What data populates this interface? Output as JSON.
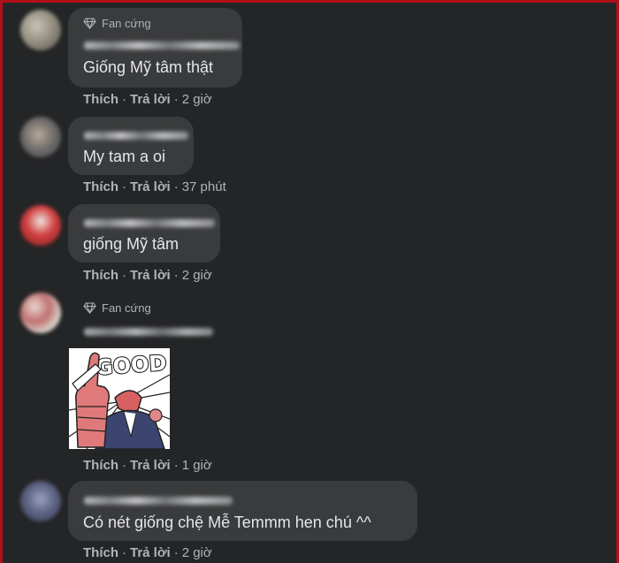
{
  "comments": [
    {
      "badge": "Fan cứng",
      "text": "Giống Mỹ tâm thật",
      "like": "Thích",
      "reply": "Trả lời",
      "time": "2 giờ"
    },
    {
      "text": "My tam a oi",
      "like": "Thích",
      "reply": "Trả lời",
      "time": "37 phút"
    },
    {
      "text": "giống Mỹ tâm",
      "like": "Thích",
      "reply": "Trả lời",
      "time": "2 giờ"
    },
    {
      "badge": "Fan cứng",
      "sticker": "GOOD",
      "like": "Thích",
      "reply": "Trả lời",
      "time": "1 giờ"
    },
    {
      "text": "Có nét giống chệ Mễ Temmm hen chú ^^",
      "like": "Thích",
      "reply": "Trả lời",
      "time": "2 giờ"
    }
  ],
  "separator": "·",
  "colors": {
    "background": "#242526",
    "bubble": "#3a3b3c",
    "text": "#e4e6eb",
    "muted": "#b0b3b8",
    "frame": "#b0101a"
  },
  "icons": {
    "badge": "diamond-icon"
  }
}
